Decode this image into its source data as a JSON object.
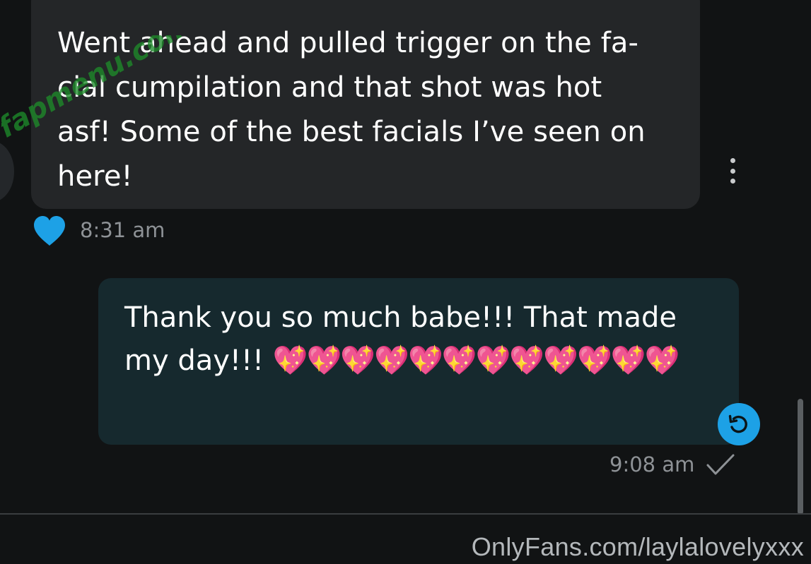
{
  "messages": {
    "incoming": {
      "text": "Went ahead and pulled trigger on the fa-\ncial cumpilation and that shot was hot\nasf! Some of the best facials I’ve seen on\nhere!",
      "time": "8:31 am",
      "liked": true
    },
    "outgoing": {
      "text": "Thank you so much babe!!! That made\nmy day!!! ",
      "emoji": "💖💖💖💖💖💖💖💖💖💖💖💖",
      "time": "9:08 am",
      "status": "sent"
    }
  },
  "watermark": {
    "text": "fapmenu.com"
  },
  "footer": {
    "source": "OnlyFans.com/laylalovelyxxx"
  },
  "colors": {
    "background": "#111314",
    "incoming_bubble": "#242628",
    "outgoing_bubble": "#16292e",
    "accent_blue": "#1da1e6",
    "watermark_green": "#1e8a2a",
    "timestamp": "#8e9296"
  },
  "icons": {
    "like": "heart-icon",
    "menu": "more-vertical-icon",
    "undo": "undo-icon",
    "status": "checkmark-icon"
  }
}
